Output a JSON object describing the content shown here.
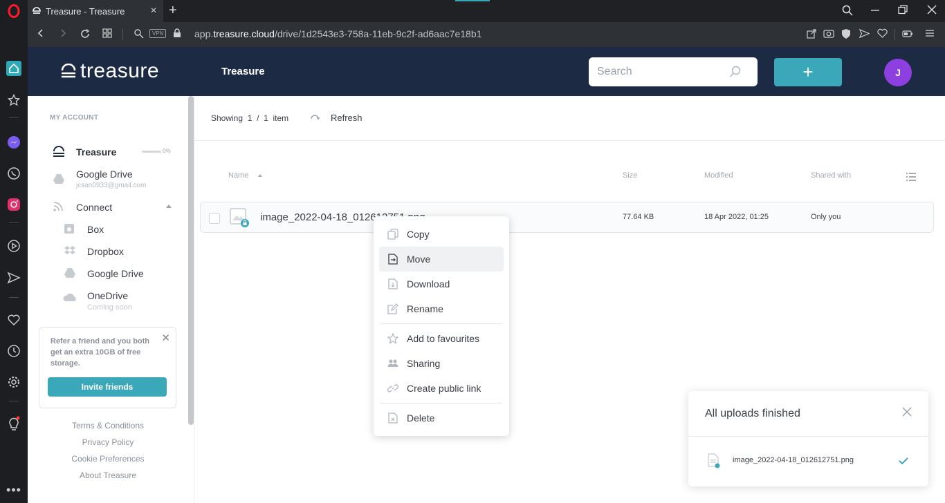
{
  "browser": {
    "tab_title": "Treasure - Treasure",
    "url_prefix": "app.",
    "url_domain": "treasure.cloud",
    "url_path": "/drive/1d2543e3-758a-11eb-9c2f-ad6aac7e18b1",
    "vpn_label": "VPN"
  },
  "app": {
    "logo_text": "treasure",
    "title": "Treasure",
    "search_placeholder": "Search",
    "add_label": "+",
    "avatar_initial": "J"
  },
  "sidebar": {
    "section_label": "MY ACCOUNT",
    "treasure_label": "Treasure",
    "quota_pct": "0%",
    "quota_fraction": 0,
    "gdrive_label": "Google Drive",
    "gdrive_email": "jcsan0933@gmail.com",
    "connect_label": "Connect",
    "connect_items": [
      {
        "label": "Box"
      },
      {
        "label": "Dropbox"
      },
      {
        "label": "Google Drive"
      },
      {
        "label": "OneDrive",
        "note": "Coming soon"
      }
    ],
    "refer_text": "Refer a friend and you both get an extra 10GB of free storage.",
    "invite_label": "Invite friends",
    "footer_links": [
      "Terms & Conditions",
      "Privacy Policy",
      "Cookie Preferences",
      "About Treasure"
    ]
  },
  "main": {
    "showing": "Showing",
    "count_a": "1",
    "slash": "/",
    "count_b": "1",
    "item_word": "item",
    "refresh_label": "Refresh",
    "columns": {
      "name": "Name",
      "size": "Size",
      "modified": "Modified",
      "shared": "Shared with"
    },
    "file": {
      "name": "image_2022-04-18_012612751.png",
      "size": "77.64 KB",
      "modified": "18 Apr 2022, 01:25",
      "shared": "Only you"
    }
  },
  "context_menu": {
    "items": [
      "Copy",
      "Move",
      "Download",
      "Rename",
      "Add to favourites",
      "Sharing",
      "Create public link",
      "Delete"
    ],
    "highlighted": "Move"
  },
  "toast": {
    "title": "All uploads finished",
    "file": "image_2022-04-18_012612751.png"
  },
  "colors": {
    "accent": "#3aa8b8",
    "header_bg": "#1d2a44",
    "avatar": "#8e3fe0",
    "browser_dark": "#1c1e22"
  }
}
